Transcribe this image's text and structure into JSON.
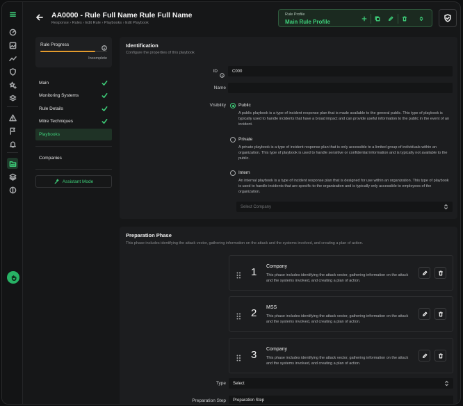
{
  "header": {
    "title": "AA0000 - Rule Full Name Rule Full Name",
    "breadcrumb": "Response › Rules › Edit Rule › Playbooks › Edit Playbook",
    "profile_label": "Rule Profile",
    "profile_value": "Main Rule Profile"
  },
  "rail": {
    "icons": [
      "menu-icon",
      "dashboard-icon",
      "image-icon",
      "trend-icon",
      "shield-icon",
      "stars-icon",
      "layers-icon",
      "alert-icon",
      "flag-icon",
      "bell-icon",
      "folder-icon",
      "stack-icon",
      "contrast-icon"
    ],
    "active": "folder-icon",
    "avatar_icon": "hand-icon"
  },
  "progress": {
    "title": "Rule Progress",
    "status": "Incomplete",
    "value": 0.82,
    "fill_color": "#e39b2d"
  },
  "nav": {
    "items": [
      {
        "label": "Main",
        "done": true
      },
      {
        "label": "Monitoring Systems",
        "done": true
      },
      {
        "label": "Rule Details",
        "done": true
      },
      {
        "label": "Mitre Techniques",
        "done": true
      },
      {
        "label": "Playbooks",
        "done": false,
        "active": true
      }
    ],
    "companies": "Companies",
    "assistant": "Assistant Mode"
  },
  "identification": {
    "title": "Identification",
    "description": "Configure the properties of this playbook",
    "id_label": "ID",
    "id_value": "C000",
    "name_label": "Name",
    "name_value": "",
    "visibility_label": "Visibility",
    "options": [
      {
        "label": "Public",
        "checked": true,
        "description": "A public playbook is a type of incident response plan that is made available to the general public. This type of playbook is typically used to handle incidents that have a broad impact and can provide useful information to the public in the event of an incident."
      },
      {
        "label": "Private",
        "checked": false,
        "description": "A private playbook is a type of incident response plan that is only accessible to a limited group of individuals within an organization. This type of playbook is used to handle sensitive or confidential information and is typically not available to the public."
      },
      {
        "label": "Intern",
        "checked": false,
        "description": "An internal playbook is a type of incident response plan that is designed for use within an organization. This type of playbook is used to handle incidents that are specific to the organization and is typically only accessible to employees of the organization."
      }
    ],
    "company_placeholder": "Select Company"
  },
  "preparation": {
    "title": "Preparation Phase",
    "description": "This phase includes identifying the attack vector, gathering information on the attack and the systems involved, and creating a plan of action.",
    "steps": [
      {
        "number": "1",
        "title": "Company",
        "description": "This phase includes identifying the attack vector, gathering information on the attack and the systems involved, and creating a plan of action."
      },
      {
        "number": "2",
        "title": "MSS",
        "description": "This phase includes identifying the attack vector, gathering information on the attack and the systems involved, and creating a plan of action."
      },
      {
        "number": "3",
        "title": "Company",
        "description": "This phase includes identifying the attack vector, gathering information on the attack and the systems involved, and creating a plan of action."
      }
    ],
    "type_label": "Type",
    "type_value": "Select",
    "step_label": "Preparation Step",
    "step_value": "Preparation Step"
  },
  "colors": {
    "accent": "#3ecf7a",
    "background": "#161718",
    "panel": "#1c1d1f"
  }
}
